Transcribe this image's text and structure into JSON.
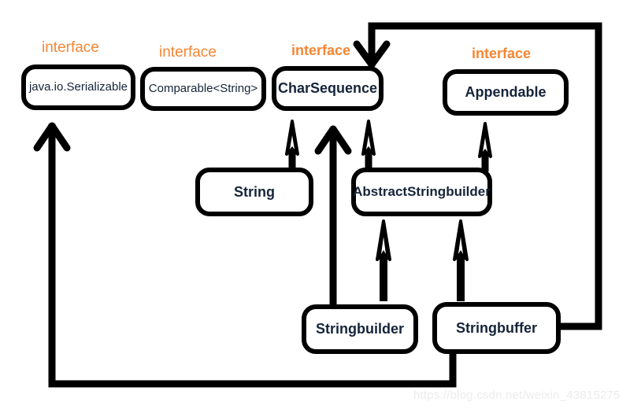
{
  "diagram": {
    "title": "Java String class hierarchy diagram",
    "background_color": "#ffffff",
    "line_color": "#000000",
    "stereotype_color": "#f58634",
    "node_text_color": "#16243a",
    "nodes": [
      {
        "id": "serializable",
        "label": "java.io.Serializable",
        "stereotype": "interface",
        "kind": "interface",
        "emphasis": "plain"
      },
      {
        "id": "comparable",
        "label": "Comparable<String>",
        "stereotype": "interface",
        "kind": "interface",
        "emphasis": "plain"
      },
      {
        "id": "charsequence",
        "label": "CharSequence",
        "stereotype": "interface",
        "kind": "interface",
        "emphasis": "bold"
      },
      {
        "id": "appendable",
        "label": "Appendable",
        "stereotype": "interface",
        "kind": "interface",
        "emphasis": "bold"
      },
      {
        "id": "string",
        "label": "String",
        "stereotype": "",
        "kind": "class",
        "emphasis": "bold"
      },
      {
        "id": "abstractstringbuilder",
        "label": "AbstractStringbuilder",
        "stereotype": "",
        "kind": "class",
        "emphasis": "bold"
      },
      {
        "id": "stringbuilder",
        "label": "Stringbuilder",
        "stereotype": "",
        "kind": "class",
        "emphasis": "bold"
      },
      {
        "id": "stringbuffer",
        "label": "Stringbuffer",
        "stereotype": "",
        "kind": "class",
        "emphasis": "bold"
      }
    ],
    "edges": [
      {
        "id": "string-to-charsequence",
        "from": "string",
        "to": "charsequence",
        "arrow": "hollow-triangle"
      },
      {
        "id": "abstractstringbuilder-to-charsequence",
        "from": "abstractstringbuilder",
        "to": "charsequence",
        "arrow": "hollow-triangle"
      },
      {
        "id": "abstractstringbuilder-to-appendable",
        "from": "abstractstringbuilder",
        "to": "appendable",
        "arrow": "hollow-triangle"
      },
      {
        "id": "stringbuilder-to-abstractstringbuilder",
        "from": "stringbuilder",
        "to": "abstractstringbuilder",
        "arrow": "hollow-triangle"
      },
      {
        "id": "stringbuffer-to-abstractstringbuilder",
        "from": "stringbuffer",
        "to": "abstractstringbuilder",
        "arrow": "hollow-triangle"
      },
      {
        "id": "stringbuilder-to-charsequence",
        "from": "stringbuilder",
        "to": "charsequence",
        "arrow": "open-vee"
      },
      {
        "id": "stringbuffer-to-charsequence",
        "from": "stringbuffer",
        "to": "charsequence",
        "arrow": "open-vee"
      },
      {
        "id": "stringbuilder-to-serializable",
        "from": "stringbuilder",
        "to": "serializable",
        "arrow": "open-vee"
      }
    ]
  },
  "watermark": {
    "text": "https://blog.csdn.net/weixin_43815275"
  }
}
